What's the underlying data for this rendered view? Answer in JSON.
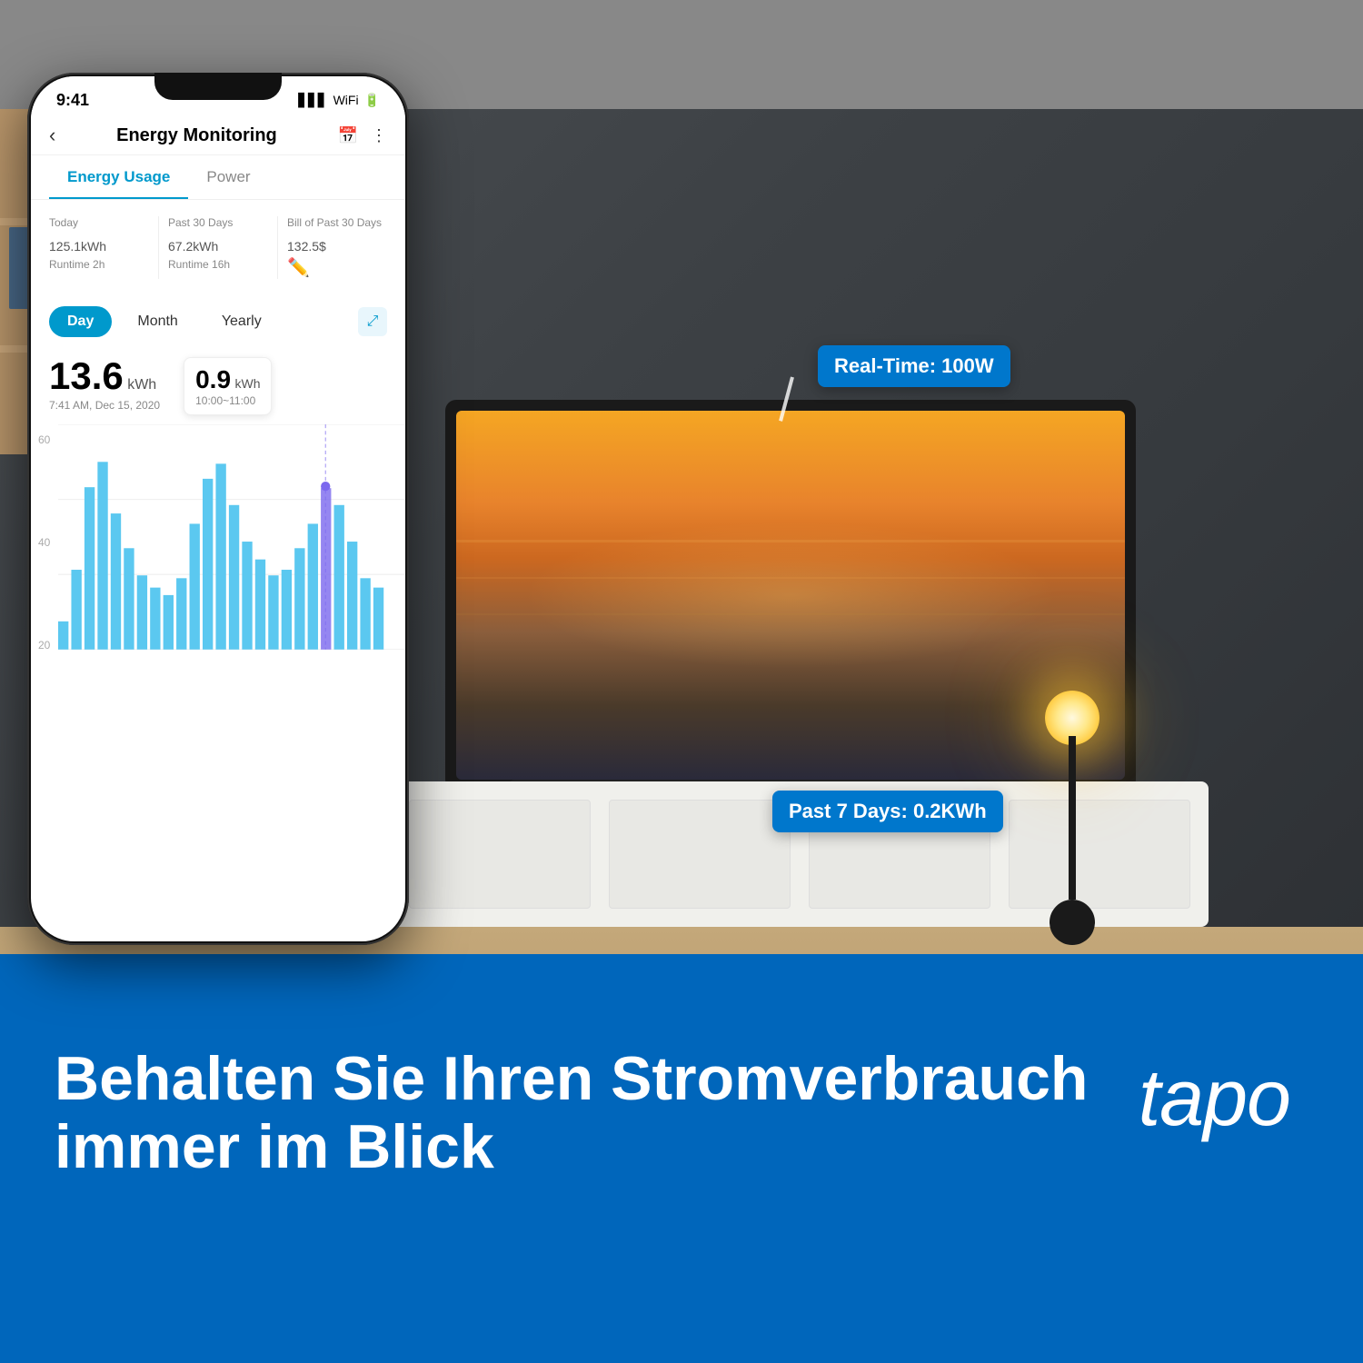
{
  "room": {
    "realtime_bubble": "Real-Time: 100W",
    "past7_bubble": "Past 7 Days: 0.2KWh"
  },
  "bottom": {
    "headline_line1": "Behalten Sie Ihren Stromverbrauch",
    "headline_line2": "immer im Blick",
    "logo": "tapo"
  },
  "phone": {
    "status_time": "9:41",
    "header": {
      "title": "Energy Monitoring",
      "back_label": "‹",
      "calendar_icon": "📅",
      "more_icon": "⋮"
    },
    "tabs": [
      {
        "label": "Energy Usage",
        "active": true
      },
      {
        "label": "Power",
        "active": false
      }
    ],
    "stats": [
      {
        "label": "Today",
        "value": "125.1",
        "unit": "kWh",
        "runtime": "Runtime 2h"
      },
      {
        "label": "Past 30 Days",
        "value": "67.2",
        "unit": "kWh",
        "runtime": "Runtime 16h"
      },
      {
        "label": "Bill of Past 30 Days",
        "value": "132.5",
        "unit": "$",
        "edit": true
      }
    ],
    "periods": [
      {
        "label": "Day",
        "active": true
      },
      {
        "label": "Month",
        "active": false
      },
      {
        "label": "Yearly",
        "active": false
      }
    ],
    "reading": {
      "value": "13.6",
      "unit": "kWh",
      "time": "7:41 AM, Dec 15, 2020"
    },
    "tooltip": {
      "value": "0.9",
      "unit": "kWh",
      "time": "10:00~11:00"
    },
    "chart": {
      "y_labels": [
        "60",
        "40",
        "20",
        ""
      ],
      "bars": [
        8,
        22,
        45,
        55,
        38,
        28,
        18,
        14,
        10,
        20,
        35,
        48,
        52,
        40,
        30,
        25,
        18,
        22,
        28,
        35,
        42,
        38,
        30,
        20,
        15
      ]
    }
  }
}
